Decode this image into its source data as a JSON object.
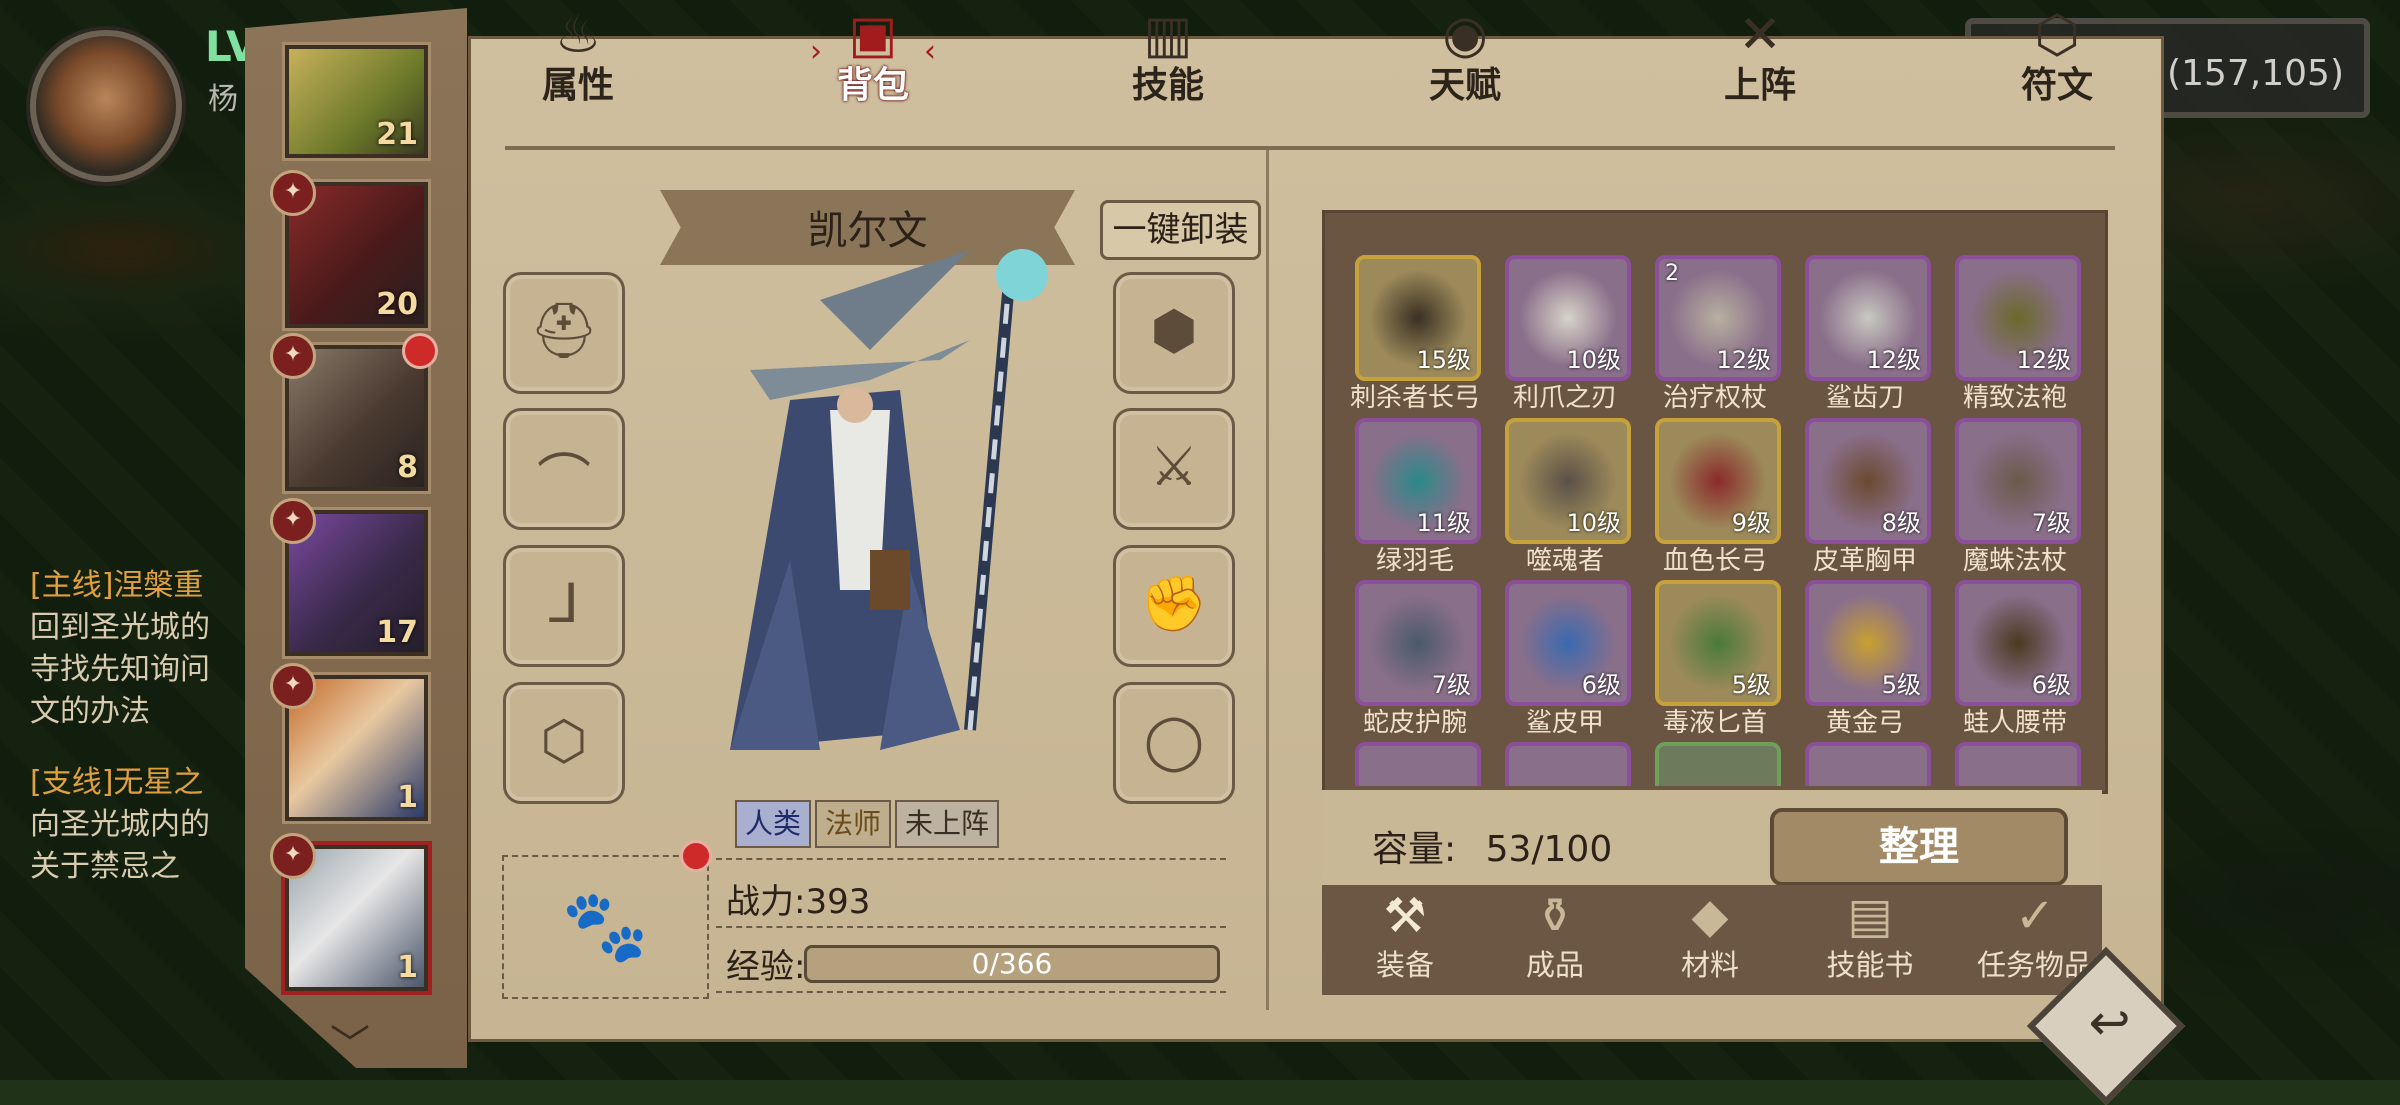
{
  "hud": {
    "level_label": "LV",
    "player_name": "杨",
    "coords": "(157,105)",
    "quests": [
      {
        "title": "[主线]涅槃重",
        "body": "回到圣光城的",
        "body2": "寺找先知询问",
        "body3": "文的办法"
      },
      {
        "title": "[支线]无星之",
        "body": "向圣光城内的",
        "body2": "关于禁忌之"
      }
    ]
  },
  "heroes": [
    {
      "level": "21"
    },
    {
      "level": "20"
    },
    {
      "level": "8",
      "has_notice": true
    },
    {
      "level": "17"
    },
    {
      "level": "1"
    },
    {
      "level": "1",
      "selected": true
    }
  ],
  "tabs": [
    {
      "label": "属性",
      "icon": "flame-icon"
    },
    {
      "label": "背包",
      "icon": "backpack-icon",
      "active": true
    },
    {
      "label": "技能",
      "icon": "book-icon"
    },
    {
      "label": "天赋",
      "icon": "eye-icon"
    },
    {
      "label": "上阵",
      "icon": "crossed-swords-icon"
    },
    {
      "label": "符文",
      "icon": "rune-icon"
    }
  ],
  "character": {
    "name": "凯尔文",
    "unequip_all": "一键卸装",
    "tags": [
      "人类",
      "法师",
      "未上阵"
    ],
    "power_label": "战力:393",
    "exp_label": "经验:",
    "exp_value": "0/366",
    "exp_progress": 0
  },
  "equip_slots_left": [
    "helmet-slot",
    "shoulder-slot",
    "boots-slot",
    "ring-slot"
  ],
  "equip_slots_right": [
    "armor-slot",
    "weapon-slot",
    "gloves-slot",
    "amulet-slot"
  ],
  "inventory": {
    "items": [
      {
        "name": "刺杀者长弓",
        "level": "15级",
        "rarity": "gold"
      },
      {
        "name": "利爪之刃",
        "level": "10级",
        "rarity": "purple"
      },
      {
        "name": "治疗权杖",
        "level": "12级",
        "rarity": "purple",
        "count": "2"
      },
      {
        "name": "鲨齿刀",
        "level": "12级",
        "rarity": "purple"
      },
      {
        "name": "精致法袍",
        "level": "12级",
        "rarity": "purple"
      },
      {
        "name": "绿羽毛",
        "level": "11级",
        "rarity": "purple"
      },
      {
        "name": "噬魂者",
        "level": "10级",
        "rarity": "gold"
      },
      {
        "name": "血色长弓",
        "level": "9级",
        "rarity": "gold"
      },
      {
        "name": "皮革胸甲",
        "level": "8级",
        "rarity": "purple"
      },
      {
        "name": "魔蛛法杖",
        "level": "7级",
        "rarity": "purple"
      },
      {
        "name": "蛇皮护腕",
        "level": "7级",
        "rarity": "purple"
      },
      {
        "name": "鲨皮甲",
        "level": "6级",
        "rarity": "purple"
      },
      {
        "name": "毒液匕首",
        "level": "5级",
        "rarity": "gold"
      },
      {
        "name": "黄金弓",
        "level": "5级",
        "rarity": "purple"
      },
      {
        "name": "蛙人腰带",
        "level": "6级",
        "rarity": "purple"
      }
    ],
    "partial_row_rarities": [
      "purple",
      "purple",
      "green",
      "purple",
      "purple"
    ],
    "capacity_label": "容量:",
    "capacity_value": "53/100",
    "sort_label": "整理"
  },
  "categories": [
    {
      "label": "装备",
      "icon": "equipment-icon",
      "active": true
    },
    {
      "label": "成品",
      "icon": "bag-icon"
    },
    {
      "label": "材料",
      "icon": "material-icon"
    },
    {
      "label": "技能书",
      "icon": "scroll-icon"
    },
    {
      "label": "任务物品",
      "icon": "quest-item-icon"
    }
  ],
  "colors": {
    "purple_rarity": "#8c4f9b",
    "gold_rarity": "#c7a23a",
    "green_rarity": "#6fa05a",
    "active_tab": "#a11d1d",
    "panel_bg": "#c9b896"
  }
}
